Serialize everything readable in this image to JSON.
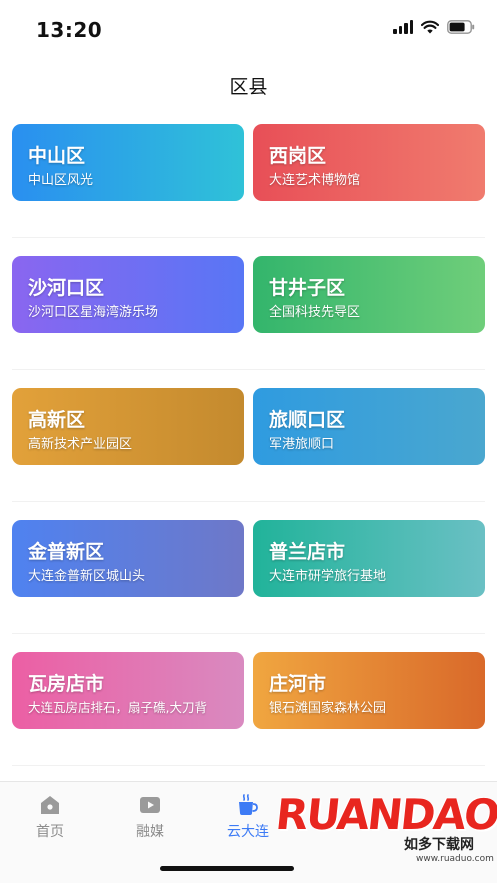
{
  "status_bar": {
    "time": "13:20"
  },
  "header": {
    "title": "区县"
  },
  "districts": [
    {
      "name": "中山区",
      "caption": "中山区风光",
      "gradient": [
        "#2a8ff0",
        "#2fc2d8"
      ]
    },
    {
      "name": "西岗区",
      "caption": "大连艺术博物馆",
      "gradient": [
        "#e84f57",
        "#f07b6e"
      ]
    },
    {
      "name": "沙河口区",
      "caption": "沙河口区星海湾游乐场",
      "gradient": [
        "#8a66f0",
        "#5876f5"
      ]
    },
    {
      "name": "甘井子区",
      "caption": "全国科技先导区",
      "gradient": [
        "#33b56c",
        "#6fce7a"
      ]
    },
    {
      "name": "高新区",
      "caption": "高新技术产业园区",
      "gradient": [
        "#e2a13a",
        "#c48a2e"
      ]
    },
    {
      "name": "旅顺口区",
      "caption": "军港旅顺口",
      "gradient": [
        "#2f9be0",
        "#4aa7cf"
      ]
    },
    {
      "name": "金普新区",
      "caption": "大连金普新区城山头",
      "gradient": [
        "#4f82f0",
        "#6e78c8"
      ]
    },
    {
      "name": "普兰店市",
      "caption": "大连市研学旅行基地",
      "gradient": [
        "#21b39a",
        "#6ac0c4"
      ]
    },
    {
      "name": "瓦房店市",
      "caption": "大连瓦房店排石，扇子礁,大刀背",
      "gradient": [
        "#ec5fa4",
        "#d98ac0"
      ]
    },
    {
      "name": "庄河市",
      "caption": "银石滩国家森林公园",
      "gradient": [
        "#f0a640",
        "#d9692a"
      ]
    }
  ],
  "tab_bar": {
    "tabs": [
      {
        "label": "首页",
        "icon": "home-icon",
        "active": false
      },
      {
        "label": "融媒",
        "icon": "video-icon",
        "active": false
      },
      {
        "label": "云大连",
        "icon": "cup-icon",
        "active": true
      }
    ]
  },
  "watermark": {
    "text": "RUANDAO",
    "sub": "如多下载网",
    "url": "www.ruaduo.com"
  },
  "colors": {
    "active": "#3d7bf5",
    "inactive": "#8c8c8c"
  }
}
